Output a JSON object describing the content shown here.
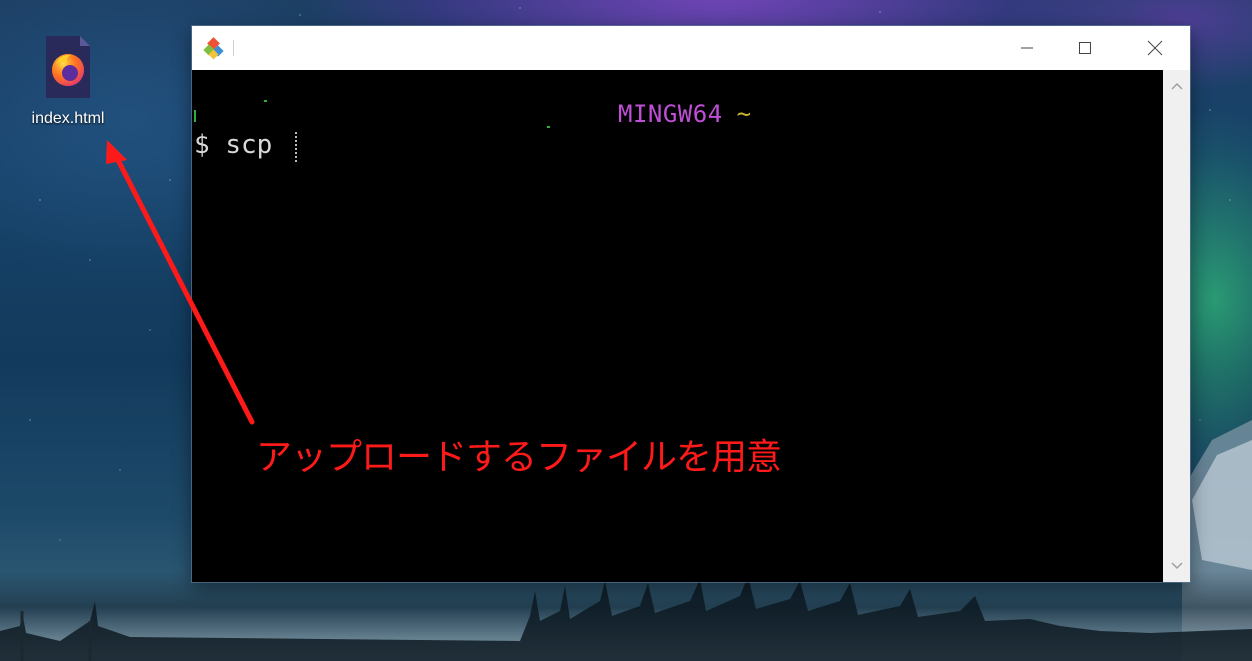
{
  "desktop": {
    "icon_label": "index.html",
    "icon_type": "firefox-html-file-icon"
  },
  "window": {
    "app_icon": "git-logo-icon",
    "controls": {
      "minimize_icon": "minimize-icon",
      "maximize_icon": "maximize-icon",
      "close_icon": "close-icon"
    },
    "terminal": {
      "host_label": "MINGW64",
      "path": "~",
      "prompt_symbol": "$",
      "command": "scp",
      "colors": {
        "host": "#bf4fd6",
        "path": "#c9b52a",
        "text": "#d8d8d8",
        "background": "#000000"
      }
    }
  },
  "annotation": {
    "text": "アップロードするファイルを用意",
    "color": "#ff1a1a"
  }
}
